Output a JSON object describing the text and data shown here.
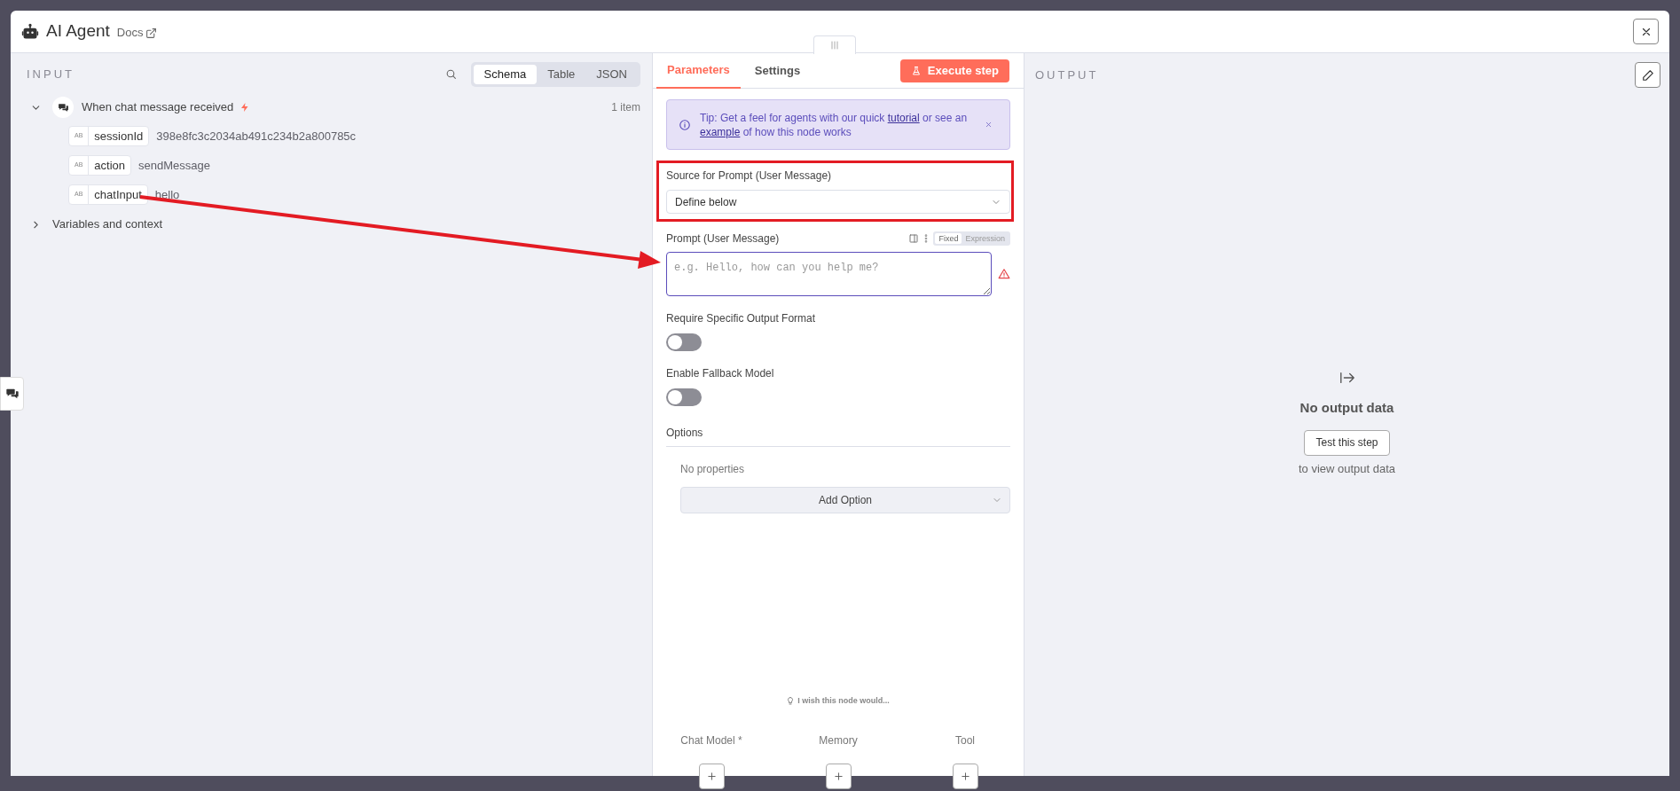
{
  "window": {
    "title": "AI Agent",
    "docs_link": "Docs"
  },
  "input_panel": {
    "heading": "INPUT",
    "view_tabs": [
      {
        "label": "Schema",
        "selected": true
      },
      {
        "label": "Table",
        "selected": false
      },
      {
        "label": "JSON",
        "selected": false
      }
    ],
    "node": {
      "name": "When chat message received",
      "expanded": true,
      "count": "1 item",
      "fields": [
        {
          "type_badge": "AB",
          "key": "sessionId",
          "value": "398e8fc3c2034ab491c234b2a800785c"
        },
        {
          "type_badge": "AB",
          "key": "action",
          "value": "sendMessage"
        },
        {
          "type_badge": "AB",
          "key": "chatInput",
          "value": "hello"
        }
      ]
    },
    "variables": {
      "label": "Variables and context",
      "expanded": false
    }
  },
  "parameters_panel": {
    "tabs": [
      {
        "label": "Parameters",
        "selected": true
      },
      {
        "label": "Settings",
        "selected": false
      }
    ],
    "execute_button": "Execute step",
    "tip": [
      {
        "text": "Tip: Get a feel for agents with our quick ",
        "link": false
      },
      {
        "text": "tutorial",
        "link": true
      },
      {
        "text": " or see an ",
        "link": false
      },
      {
        "text": "example",
        "link": true
      },
      {
        "text": " of how this node works",
        "link": false
      }
    ],
    "source_field": {
      "label": "Source for Prompt (User Message)",
      "value": "Define below"
    },
    "prompt_field": {
      "label": "Prompt (User Message)",
      "placeholder": "e.g. Hello, how can you help me?",
      "mode_tabs": [
        {
          "label": "Fixed",
          "selected": true
        },
        {
          "label": "Expression",
          "selected": false
        }
      ],
      "error": true
    },
    "toggles": [
      {
        "label": "Require Specific Output Format",
        "on": false
      },
      {
        "label": "Enable Fallback Model",
        "on": false
      }
    ],
    "options": {
      "heading": "Options",
      "empty_text": "No properties",
      "add_button": "Add Option"
    },
    "feedback": "I wish this node would...",
    "connections": [
      {
        "label": "Chat Model *"
      },
      {
        "label": "Memory"
      },
      {
        "label": "Tool"
      }
    ]
  },
  "output_panel": {
    "heading": "OUTPUT",
    "empty_title": "No output data",
    "test_button": "Test this step",
    "hint": "to view output data"
  }
}
